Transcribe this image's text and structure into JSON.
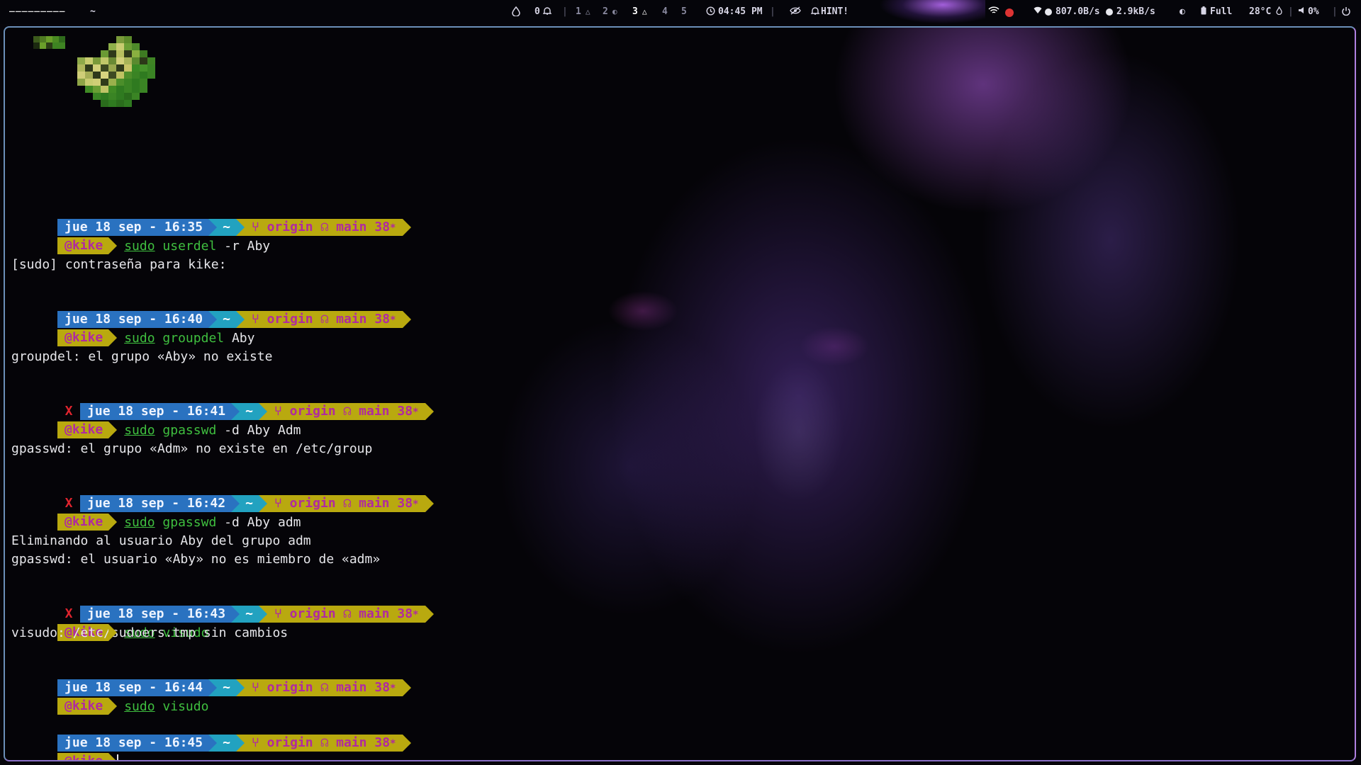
{
  "topbar": {
    "user": "_________",
    "tilde": "~",
    "notif_count": "0",
    "workspaces": [
      "1",
      "2",
      "3",
      "4",
      "5"
    ],
    "active_workspace": "3",
    "clock": "04:45 PM",
    "hint": "HINT!",
    "net_down": "807.0B/s",
    "net_up": "2.9kB/s",
    "battery": "Full",
    "temperature": "28°C",
    "volume": "0%"
  },
  "terminal": {
    "git_remote": "origin",
    "git_branch": "main",
    "git_count": "38",
    "dir": "~",
    "user": "@kike",
    "blocks": [
      {
        "date": "jue 18 sep - 16:35",
        "error": false,
        "cmd_bin": "userdel",
        "cmd_args": "-r Aby",
        "output": [
          "[sudo] contraseña para kike:"
        ]
      },
      {
        "date": "jue 18 sep - 16:40",
        "error": false,
        "cmd_bin": "groupdel",
        "cmd_args": "Aby",
        "output": [
          "groupdel: el grupo «Aby» no existe"
        ]
      },
      {
        "date": "jue 18 sep - 16:41",
        "error": true,
        "cmd_bin": "gpasswd",
        "cmd_args": "-d Aby Adm",
        "output": [
          "gpasswd: el grupo «Adm» no existe en /etc/group"
        ]
      },
      {
        "date": "jue 18 sep - 16:42",
        "error": true,
        "cmd_bin": "gpasswd",
        "cmd_args": "-d Aby adm",
        "output": [
          "Eliminando al usuario Aby del grupo adm",
          "gpasswd: el usuario «Aby» no es miembro de «adm»"
        ]
      },
      {
        "date": "jue 18 sep - 16:43",
        "error": true,
        "cmd_bin": "visudo",
        "cmd_args": "",
        "output": [
          "visudo: /etc/sudoers.tmp sin cambios"
        ]
      },
      {
        "date": "jue 18 sep - 16:44",
        "error": false,
        "cmd_bin": "visudo",
        "cmd_args": "",
        "output": []
      },
      {
        "date": "jue 18 sep - 16:45",
        "error": false,
        "cmd_bin": "",
        "cmd_args": "",
        "output": []
      }
    ],
    "sudo": "sudo",
    "error_mark": "X"
  },
  "icons": {
    "branch": "branch-icon",
    "github": "github-icon",
    "star": "star-icon"
  }
}
